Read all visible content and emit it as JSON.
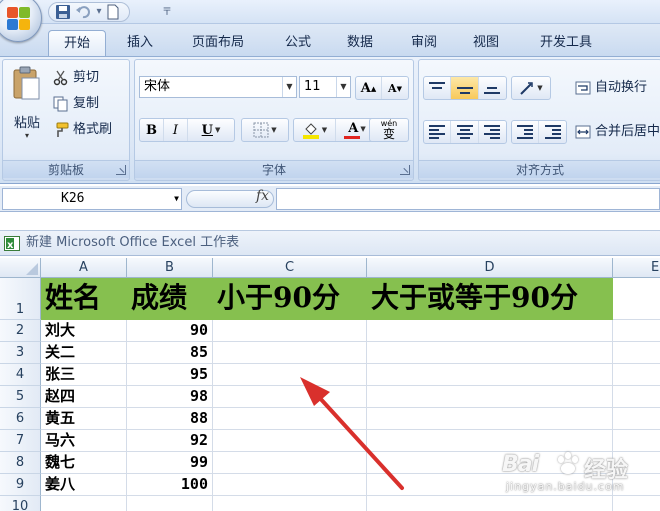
{
  "ribbon": {
    "tabs": [
      {
        "label": "开始",
        "active": true
      },
      {
        "label": "插入"
      },
      {
        "label": "页面布局"
      },
      {
        "label": "公式"
      },
      {
        "label": "数据"
      },
      {
        "label": "审阅"
      },
      {
        "label": "视图"
      },
      {
        "label": "开发工具"
      }
    ],
    "clipboard": {
      "paste_label": "粘贴",
      "cut_label": "剪切",
      "copy_label": "复制",
      "format_painter_label": "格式刷",
      "group_label": "剪贴板"
    },
    "font": {
      "font_name": "宋体",
      "font_size": "11",
      "grow_label": "A",
      "shrink_label": "A",
      "bold_label": "B",
      "italic_label": "I",
      "underline_label": "U",
      "font_color_label": "A",
      "phonetic_label": "wén",
      "phonetic_char": "变",
      "group_label": "字体"
    },
    "alignment": {
      "wrap_text_label": "自动换行",
      "merge_center_label": "合并后居中",
      "group_label": "对齐方式"
    }
  },
  "formula_bar": {
    "name_box": "K26",
    "fx_label": "fx",
    "formula": ""
  },
  "workbook": {
    "title": "新建 Microsoft Office Excel 工作表"
  },
  "sheet": {
    "columns": [
      "A",
      "B",
      "C",
      "D",
      "E"
    ],
    "row_numbers": [
      "1",
      "2",
      "3",
      "4",
      "5",
      "6",
      "7",
      "8",
      "9",
      "10"
    ],
    "header_row": [
      "姓名",
      "成绩",
      "小于90分",
      "大于或等于90分"
    ],
    "rows": [
      {
        "name": "刘大",
        "score": "90"
      },
      {
        "name": "关二",
        "score": "85"
      },
      {
        "name": "张三",
        "score": "95"
      },
      {
        "name": "赵四",
        "score": "98"
      },
      {
        "name": "黄五",
        "score": "88"
      },
      {
        "name": "马六",
        "score": "92"
      },
      {
        "name": "魏七",
        "score": "99"
      },
      {
        "name": "姜八",
        "score": "100"
      }
    ],
    "header_color": "#86c04f"
  },
  "annotation": {
    "arrow_color": "#d9302c"
  },
  "watermark": {
    "brand": "Bai",
    "brand_cn": "经验",
    "url": "jingyan.baidu.com"
  }
}
